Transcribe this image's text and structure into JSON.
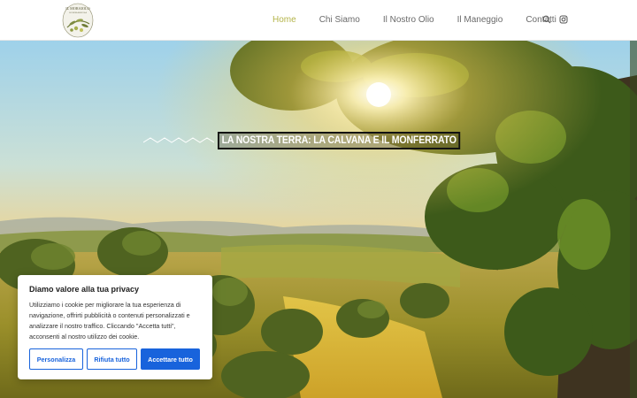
{
  "header": {
    "logo_text": "IL MORAIOLO",
    "logo_sub": "SOCIETA' AGRICOLA",
    "nav": [
      {
        "label": "Home",
        "active": true
      },
      {
        "label": "Chi Siamo",
        "active": false
      },
      {
        "label": "Il Nostro Olio",
        "active": false
      },
      {
        "label": "Il Maneggio",
        "active": false
      },
      {
        "label": "Contatti",
        "active": false
      }
    ],
    "icons": [
      "search-icon",
      "instagram-icon"
    ],
    "accent_color": "#b4b44a"
  },
  "hero": {
    "title": "La nostra terra: la Calvana e il Monferrato"
  },
  "cookie": {
    "title": "Diamo valore alla tua privacy",
    "text": "Utilizziamo i cookie per migliorare la tua esperienza di navigazione, offrirti pubblicità o contenuti personalizzati e analizzare il nostro traffico. Cliccando \"Accetta tutti\", acconsenti al nostro utilizzo dei cookie.",
    "customize_label": "Personalizza",
    "reject_label": "Rifiuta tutto",
    "accept_label": "Accettare tutto",
    "button_color": "#1863dc"
  }
}
